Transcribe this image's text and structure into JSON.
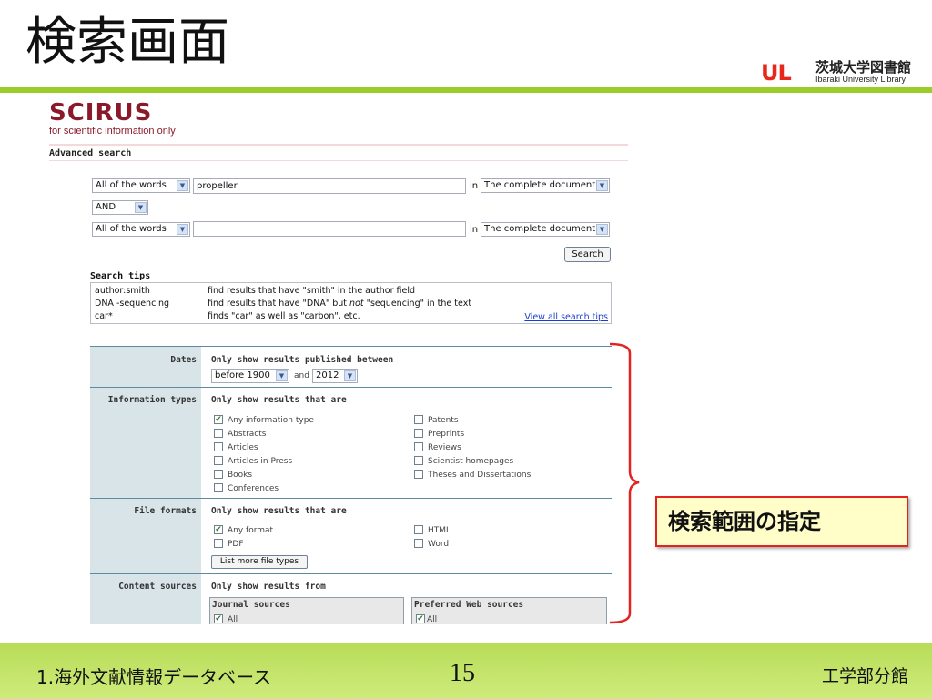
{
  "slide": {
    "title": "検索画面",
    "logo": {
      "mark": "UL",
      "jp": "茨城大学図書館",
      "en": "Ibaraki University Library"
    },
    "callout": "検索範囲の指定"
  },
  "scirus": {
    "logo": "SCIRUS",
    "tagline": "for scientific information only",
    "advanced_label": "Advanced search",
    "query_rows": [
      {
        "field": "All of the words",
        "value": "propeller",
        "in_label": "in",
        "scope": "The complete document"
      },
      {
        "operator": "AND"
      },
      {
        "field": "All of the words",
        "value": "",
        "in_label": "in",
        "scope": "The complete document"
      }
    ],
    "search_button": "Search",
    "tips": {
      "title": "Search tips",
      "rows": [
        {
          "example": "author:smith",
          "desc": "find results that have \"smith\" in the author field"
        },
        {
          "example": "DNA -sequencing",
          "desc_a": "find results that have \"DNA\" but ",
          "desc_em": "not",
          "desc_b": " \"sequencing\" in the text"
        },
        {
          "example": "car*",
          "desc": "finds \"car\" as well as \"carbon\", etc."
        }
      ],
      "link": "View all search tips"
    },
    "filters": {
      "dates": {
        "label": "Dates",
        "heading": "Only show results published between",
        "from": "before 1900",
        "and": "and",
        "to": "2012"
      },
      "info_types": {
        "label": "Information types",
        "heading": "Only show results that are",
        "left": [
          "Any information type",
          "Abstracts",
          "Articles",
          "Articles in Press",
          "Books",
          "Conferences"
        ],
        "right": [
          "Patents",
          "Preprints",
          "Reviews",
          "Scientist homepages",
          "Theses and Dissertations"
        ],
        "checked": "Any information type"
      },
      "file_formats": {
        "label": "File formats",
        "heading": "Only show results that are",
        "left": [
          "Any format",
          "PDF"
        ],
        "right": [
          "HTML",
          "Word"
        ],
        "checked": "Any format",
        "more_button": "List more file types"
      },
      "content_sources": {
        "label": "Content sources",
        "heading": "Only show results from",
        "journal_title": "Journal sources",
        "journal_all": "All",
        "web_title": "Preferred Web sources",
        "web_all": "All"
      }
    }
  },
  "footer": {
    "left": "1.海外文献情報データベース",
    "page": "15",
    "right": "工学部分館"
  },
  "colors": {
    "accent_green": "#9ccc2a",
    "callout_border": "#e32222",
    "scirus_red": "#8a1a2a",
    "link_blue": "#1a3ccf"
  }
}
